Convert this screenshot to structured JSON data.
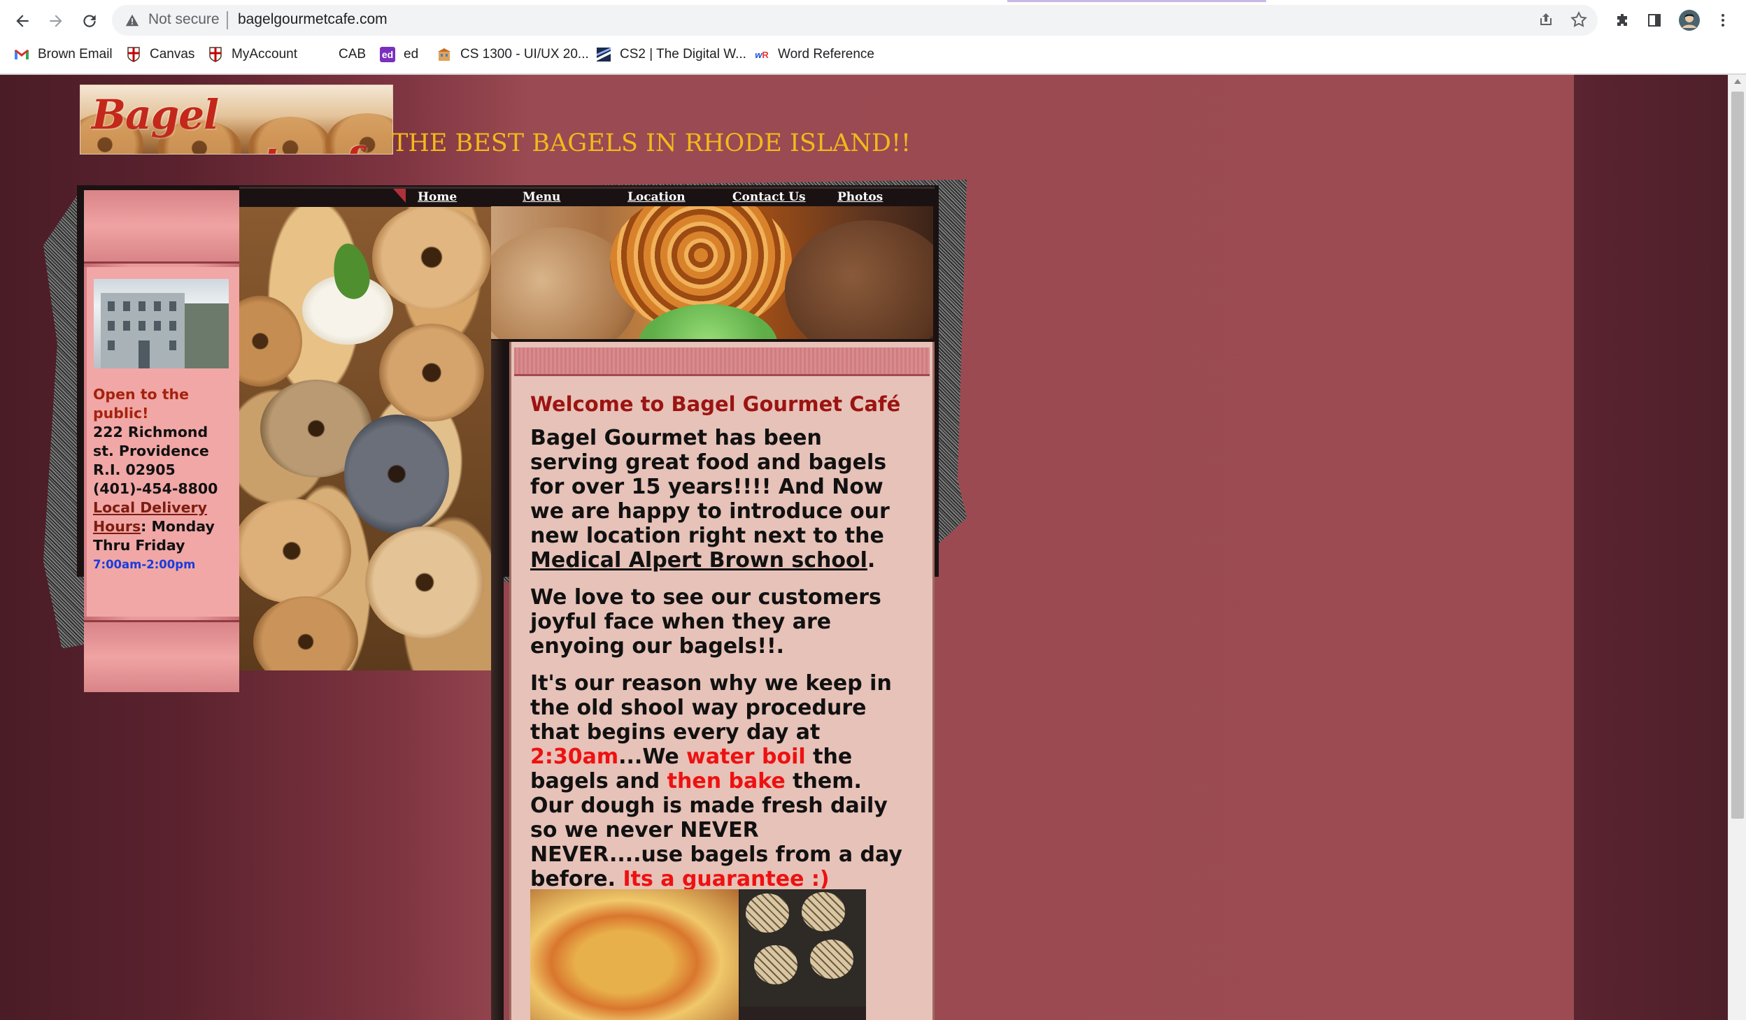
{
  "browser": {
    "security_label": "Not secure",
    "url": "bagelgourmetcafe.com",
    "bookmarks": [
      {
        "label": "Brown Email",
        "icon": "gmail-icon"
      },
      {
        "label": "Canvas",
        "icon": "brown-shield-icon"
      },
      {
        "label": "MyAccount",
        "icon": "brown-shield-icon"
      },
      {
        "label": "CAB",
        "icon": "blank-icon"
      },
      {
        "label": "ed",
        "icon": "ed-icon"
      },
      {
        "label": "CS 1300 - UI/UX 20...",
        "icon": "building-icon"
      },
      {
        "label": "CS2 | The Digital W...",
        "icon": "cs2-icon"
      },
      {
        "label": "Word Reference",
        "icon": "wr-icon"
      }
    ]
  },
  "site": {
    "logo_text": "Bagel gourmet cafe",
    "tagline": "THE BEST BAGELS IN RHODE ISLAND!!",
    "nav": [
      "Home",
      "Menu",
      "Location",
      "Contact Us",
      "Photos"
    ],
    "sidebar": {
      "open": "Open to the public!",
      "address": "222 Richmond st. Providence R.I. 02905",
      "phone": "(401)-454-8800",
      "delivery_link": "Local Delivery Hours",
      "delivery_days": ": Monday Thru Friday",
      "hours": "7:00am-2:00pm"
    },
    "content": {
      "title": "Welcome to Bagel Gourmet Café",
      "p1_a": "Bagel Gourmet has been serving great food and bagels for over 15 years!!!! And Now we are happy to introduce our new location right next to the ",
      "p1_link": "Medical Alpert Brown school",
      "p1_end": ".",
      "p2": "We love to see our customers joyful face when they are enyoing our bagels!!.",
      "p3_a": "It's our reason why we keep in the old shool way procedure that begins every day at ",
      "p3_time": "2:30am",
      "p3_b": "...We ",
      "p3_boil": "water boil",
      "p3_c": " the bagels and ",
      "p3_bake": "then bake",
      "p3_d": " them. Our dough is made fresh daily so we never NEVER NEVER....use bagels from a day before. ",
      "p3_guarantee": "Its a guarantee :)"
    }
  },
  "colors": {
    "tagline": "#f3b91b",
    "title_red": "#9b1412",
    "highlight_red": "#ee1111",
    "hours_blue": "#1a3bdc",
    "sidebar_pink": "#f1a7a6",
    "content_bg": "#e7c2b8"
  }
}
